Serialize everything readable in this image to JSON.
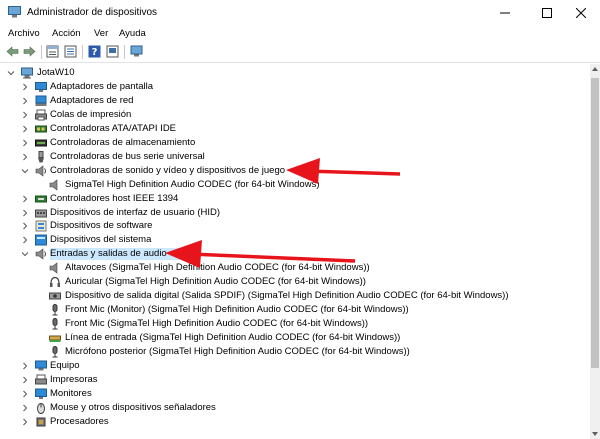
{
  "window": {
    "title": "Administrador de dispositivos"
  },
  "menu": [
    "Archivo",
    "Acción",
    "Ver",
    "Ayuda"
  ],
  "tree": {
    "root": "JotaW10",
    "items": [
      {
        "label": "Adaptadores de pantalla",
        "icon": "display-adapter-icon"
      },
      {
        "label": "Adaptadores de red",
        "icon": "network-adapter-icon"
      },
      {
        "label": "Colas de impresión",
        "icon": "print-queue-icon"
      },
      {
        "label": "Controladoras ATA/ATAPI IDE",
        "icon": "ide-controller-icon"
      },
      {
        "label": "Controladoras de almacenamiento",
        "icon": "storage-controller-icon"
      },
      {
        "label": "Controladoras de bus serie universal",
        "icon": "usb-controller-icon"
      },
      {
        "label": "Controladoras de sonido y vídeo y dispositivos de juego",
        "icon": "sound-controller-icon",
        "expanded": true,
        "children": [
          "SigmaTel High Definition Audio CODEC (for 64-bit Windows)"
        ]
      },
      {
        "label": "Controladores host IEEE 1394",
        "icon": "ieee1394-icon"
      },
      {
        "label": "Dispositivos de interfaz de usuario (HID)",
        "icon": "hid-icon"
      },
      {
        "label": "Dispositivos de software",
        "icon": "software-device-icon"
      },
      {
        "label": "Dispositivos del sistema",
        "icon": "system-device-icon"
      },
      {
        "label": "Entradas y salidas de audio",
        "icon": "audio-io-icon",
        "expanded": true,
        "selected": true,
        "children": [
          "Altavoces (SigmaTel High Definition Audio CODEC (for 64-bit Windows))",
          "Auricular (SigmaTel High Definition Audio CODEC (for 64-bit Windows))",
          "Dispositivo de salida digital (Salida SPDIF) (SigmaTel High Definition Audio CODEC (for 64-bit Windows))",
          "Front Mic (Monitor) (SigmaTel High Definition Audio CODEC (for 64-bit Windows))",
          "Front Mic (SigmaTel High Definition Audio CODEC (for 64-bit Windows))",
          "Línea de entrada (SigmaTel High Definition Audio CODEC (for 64-bit Windows))",
          "Micrófono posterior (SigmaTel High Definition Audio CODEC (for 64-bit Windows))"
        ]
      },
      {
        "label": "Equipo",
        "icon": "computer-icon"
      },
      {
        "label": "Impresoras",
        "icon": "printer-icon"
      },
      {
        "label": "Monitores",
        "icon": "monitor-icon"
      },
      {
        "label": "Mouse y otros dispositivos señaladores",
        "icon": "mouse-icon"
      },
      {
        "label": "Procesadores",
        "icon": "processor-icon"
      }
    ]
  },
  "annotations": {
    "arrow_color": "#e8141c"
  }
}
